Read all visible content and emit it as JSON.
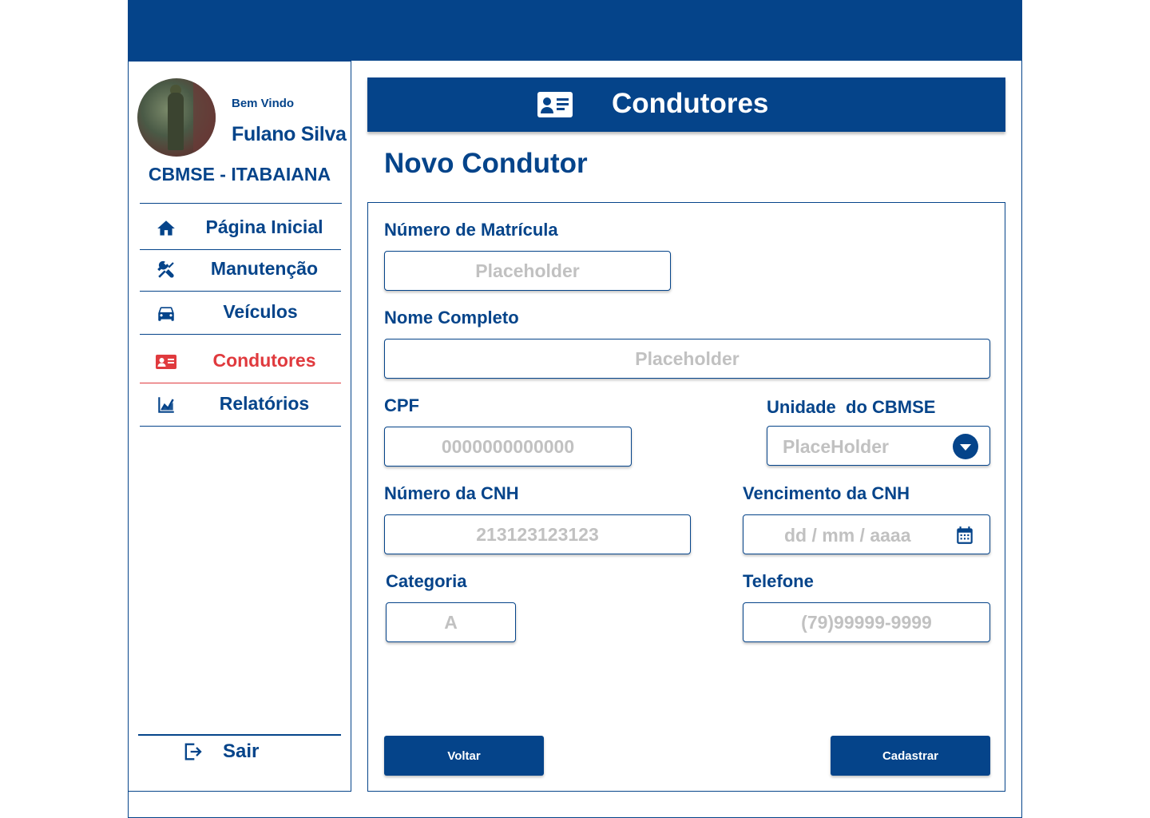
{
  "sidebar": {
    "welcome": "Bem Vindo",
    "user_name": "Fulano Silva",
    "unit": "CBMSE - ITABAIANA",
    "items": [
      {
        "label": "Página Inicial",
        "icon": "home-icon",
        "active": false
      },
      {
        "label": "Manutenção",
        "icon": "tools-icon",
        "active": false
      },
      {
        "label": "Veículos",
        "icon": "car-icon",
        "active": false
      },
      {
        "label": "Condutores",
        "icon": "id-card-icon",
        "active": true
      },
      {
        "label": "Relatórios",
        "icon": "chart-icon",
        "active": false
      }
    ],
    "logout_label": "Sair"
  },
  "header": {
    "title": "Condutores",
    "icon": "id-card-icon"
  },
  "page_title": "Novo Condutor",
  "form": {
    "matricula": {
      "label": "Número de Matrícula",
      "placeholder": "Placeholder"
    },
    "nome": {
      "label": "Nome Completo",
      "placeholder": "Placeholder"
    },
    "cpf": {
      "label": "CPF",
      "placeholder": "0000000000000"
    },
    "unidade": {
      "label": "Unidade  do CBMSE",
      "value": "PlaceHolder"
    },
    "cnh": {
      "label": "Número da CNH",
      "placeholder": "213123123123"
    },
    "vencimento": {
      "label": "Vencimento da CNH",
      "placeholder": "dd / mm / aaaa"
    },
    "categoria": {
      "label": "Categoria",
      "placeholder": "A"
    },
    "telefone": {
      "label": "Telefone",
      "placeholder": "(79)99999-9999"
    }
  },
  "buttons": {
    "back": "Voltar",
    "submit": "Cadastrar"
  },
  "colors": {
    "primary": "#05448a",
    "active": "#e03a3e",
    "placeholder": "#c1c1c1"
  }
}
